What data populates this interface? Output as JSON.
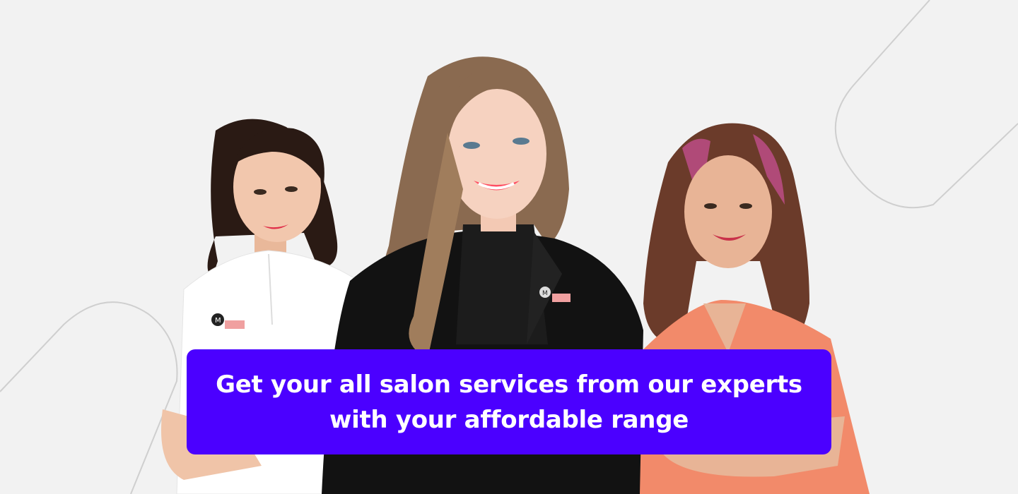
{
  "colors": {
    "background": "#f2f2f2",
    "accent": "#4b00ff",
    "banner_text": "#ffffff",
    "outline_stroke": "#c8c8c8",
    "left_uniform": "#ffffff",
    "center_blazer": "#111111",
    "right_uniform": "#f28a6a"
  },
  "icons": {
    "decorative_outline": "rounded-outline-shape",
    "badge_logo": "m-logo-badge"
  },
  "banner": {
    "line1": "Get your all salon services from our experts",
    "line2": "with your affordable range"
  }
}
